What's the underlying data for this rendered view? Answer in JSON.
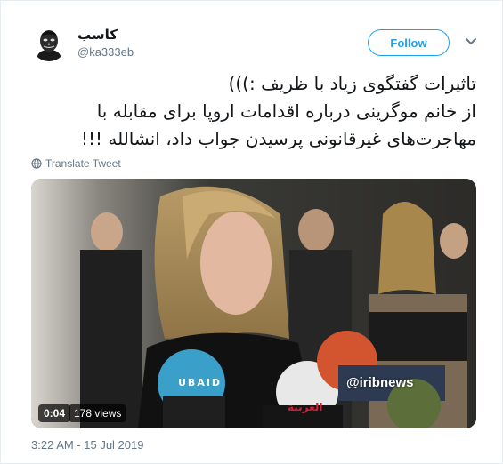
{
  "user": {
    "display_name": "کاسب",
    "handle": "@ka333eb",
    "follow_label": "Follow",
    "avatar_icon": "anonymous-mask-avatar"
  },
  "tweet": {
    "lines": [
      "تاثیرات گفتگوی زیاد با ظریف :)))",
      "از خانم موگرینی درباره اقدامات اروپا برای مقابله با",
      "مهاجرت‌های غیرقانونی پرسیدن  جواب داد، انشالله !!!"
    ],
    "translate_label": "Translate Tweet",
    "timestamp": "3:22 AM - 15 Jul 2019"
  },
  "media": {
    "duration": "0:04",
    "views": "178 views",
    "watermark": "@iribnews",
    "mic_text_1": "UBAID",
    "mic_text_2": "العربية"
  },
  "colors": {
    "accent": "#1da1f2",
    "secondary_text": "#657786",
    "border": "#e6ecf0"
  }
}
